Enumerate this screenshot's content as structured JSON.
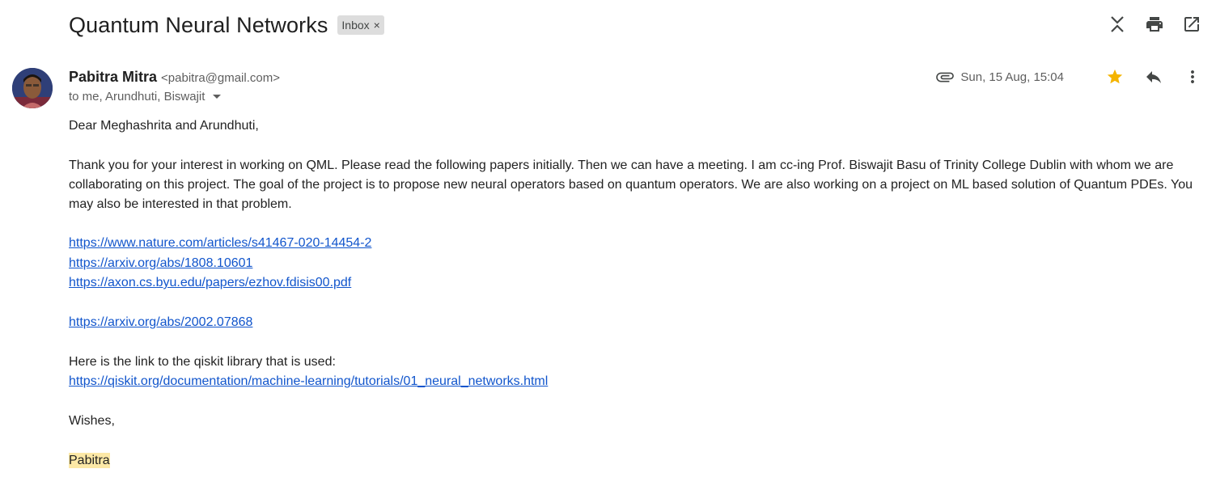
{
  "subject": "Quantum Neural Networks",
  "label_chip": {
    "text": "Inbox",
    "remove_symbol": "×"
  },
  "sender": {
    "name": "Pabitra Mitra",
    "email": "<pabitra@gmail.com>",
    "recipients": "to me, Arundhuti, Biswajit"
  },
  "date": "Sun, 15 Aug, 15:04",
  "colors": {
    "link": "#1155cc",
    "star": "#f4b400",
    "highlight": "#fce8a6"
  },
  "icons": [
    "collapse-icon",
    "print-icon",
    "open-in-new-window-icon",
    "attachment-icon",
    "star-icon",
    "reply-icon",
    "more-vert-icon"
  ],
  "body": {
    "greeting": "Dear Meghashrita and Arundhuti,",
    "paragraph": "Thank you for your interest in working on QML. Please read the following papers initially. Then we can have a meeting. I am cc-ing Prof. Biswajit Basu of Trinity College Dublin with whom we are collaborating on this project. The goal of the project is to propose new neural operators based on quantum operators. We are also working on a project on ML based solution of Quantum PDEs. You may also be interested in that problem.",
    "links_group1": [
      "https://www.nature.com/articles/s41467-020-14454-2",
      "https://arxiv.org/abs/1808.10601",
      "https://axon.cs.byu.edu/papers/ezhov.fdisis00.pdf"
    ],
    "link_single": "https://arxiv.org/abs/2002.07868",
    "qiskit_intro": "Here is the link to the qiskit library that is used:",
    "qiskit_link": "https://qiskit.org/documentation/machine-learning/tutorials/01_neural_networks.html",
    "closing": "Wishes,",
    "signature": "Pabitra"
  }
}
